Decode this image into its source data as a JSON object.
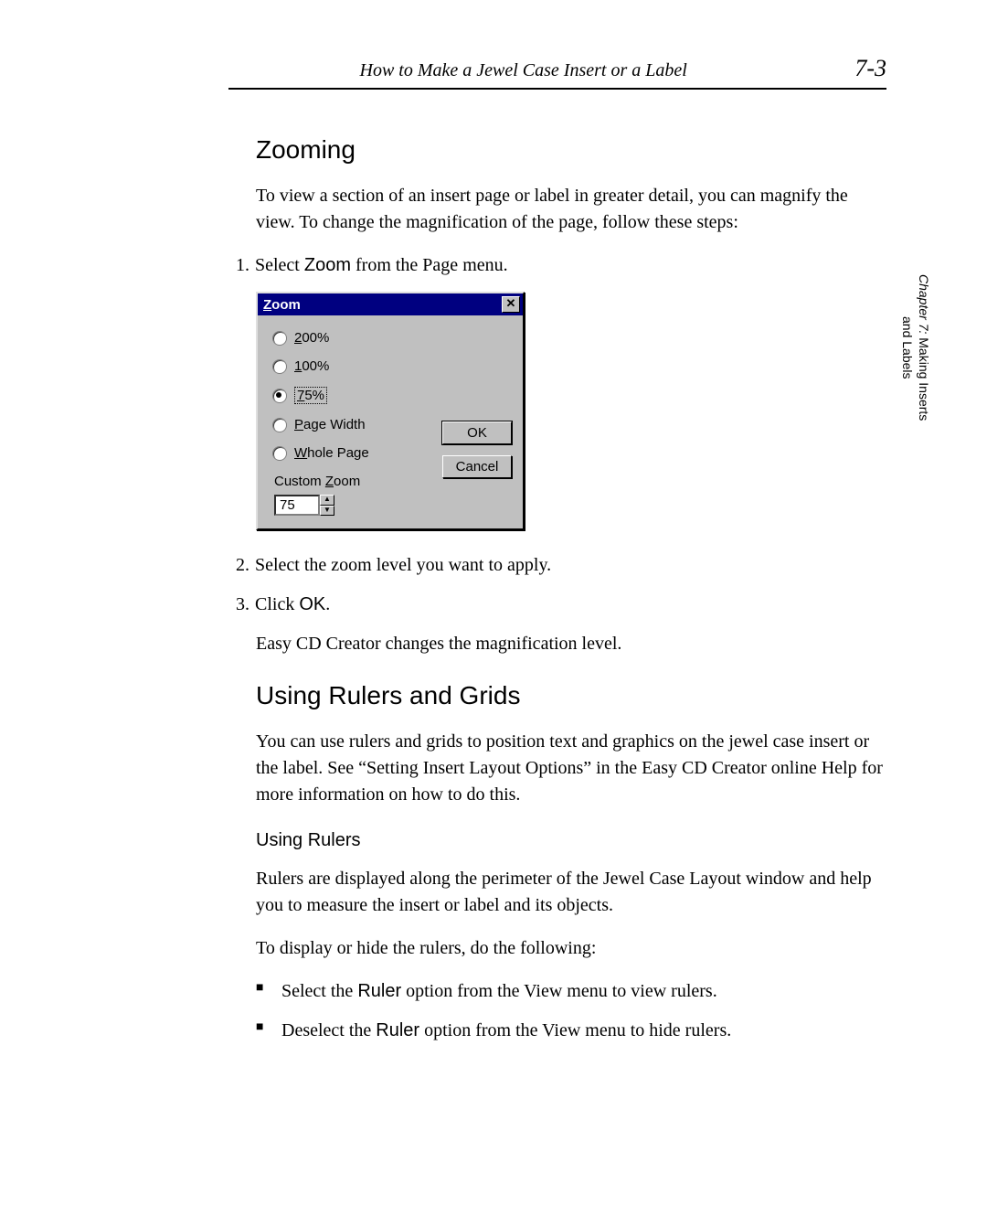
{
  "header": {
    "running_title": "How to Make a Jewel Case Insert or a Label",
    "page_number": "7-3"
  },
  "side_tab": {
    "line1_prefix": "Chapter 7:",
    "line1_rest": " Making Inserts",
    "line2": "and Labels"
  },
  "section_zoom": {
    "heading": "Zooming",
    "intro": "To view a section of an insert page or label in greater detail, you can magnify the view. To change the magnification of the page, follow these steps:",
    "step1_num": "1.",
    "step1_a": "Select ",
    "step1_zoom": "Zoom",
    "step1_b": " from the Page menu.",
    "step2_num": "2.",
    "step2": "Select the zoom level you want to apply.",
    "step3_num": "3.",
    "step3_a": "Click ",
    "step3_ok": "OK",
    "step3_b": ".",
    "result": "Easy CD Creator changes the magnification level."
  },
  "dialog": {
    "title_u": "Z",
    "title_rest": "oom",
    "close_glyph": "✕",
    "options": {
      "o200_u": "2",
      "o200_rest": "00%",
      "o100_u": "1",
      "o100_rest": "00%",
      "o75_u": "7",
      "o75_rest": "5%",
      "opw_u": "P",
      "opw_rest": "age Width",
      "owp_u": "W",
      "owp_rest": "hole Page"
    },
    "custom_label_a": "Custom ",
    "custom_label_u": "Z",
    "custom_label_b": "oom",
    "custom_value": "75",
    "ok": "OK",
    "cancel": "Cancel"
  },
  "section_rulers": {
    "heading": "Using Rulers and Grids",
    "intro": "You can use rulers and grids to position text and graphics on the jewel case insert or the label. See “Setting Insert Layout Options” in the Easy CD Creator online Help for more information on how to do this.",
    "sub_heading": "Using Rulers",
    "p1": "Rulers are displayed along the perimeter of the Jewel Case Layout window and help you to measure the insert or label and its objects.",
    "p2": "To display or hide the rulers, do the following:",
    "bullet1_a": "Select the ",
    "bullet1_ruler": "Ruler",
    "bullet1_b": " option from the View menu to view rulers.",
    "bullet2_a": "Deselect the ",
    "bullet2_ruler": "Ruler",
    "bullet2_b": " option from the View menu to hide rulers."
  }
}
